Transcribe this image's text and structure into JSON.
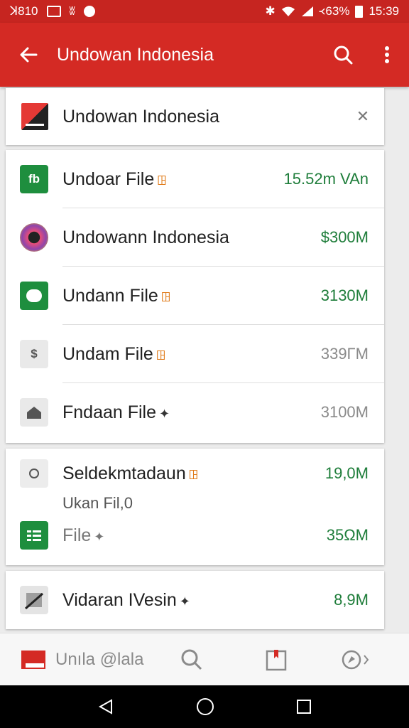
{
  "status_bar": {
    "left_text": "ꓘ810",
    "right_text": "᚜63%",
    "time": "15:39",
    "icons": [
      "image-icon",
      "bluetooth-icon",
      "dot-icon",
      "wifi-icon",
      "signal-icon",
      "battery-icon"
    ]
  },
  "appbar": {
    "title": "Undowan Indonesia",
    "icons": [
      "back-arrow-icon",
      "search-icon",
      "more-vert-icon"
    ]
  },
  "header_card": {
    "title": "Undowan Indonesia",
    "close_symbol": "✕"
  },
  "list": [
    {
      "name": "Undoar File",
      "tag": "ꖸ",
      "size": "15.52m VAn",
      "size_color": "green",
      "icon": "app-green-icon"
    },
    {
      "name": "Undowann Indonesia",
      "tag": "",
      "size": "$300M",
      "size_color": "green",
      "icon": "colorful-disc-icon"
    },
    {
      "name": "Undann File",
      "tag": "ꖸ",
      "size": "3130M",
      "size_color": "green",
      "icon": "chat-bubble-icon"
    },
    {
      "name": "Undam File",
      "tag": "ꖸ",
      "size": "339ΓM",
      "size_color": "grey",
      "icon": "dollar-doc-icon"
    },
    {
      "name": "Fndaan File",
      "tag": "✦",
      "size": "3100M",
      "size_color": "grey",
      "icon": "house-icon"
    }
  ],
  "section": {
    "title": "Seldekmtadaun",
    "tag": "ꖸ",
    "size": "19,0M",
    "subtitle": "Ukan Fil,0",
    "file_label": "File",
    "file_tag": "✦",
    "file_size": "35ΩM"
  },
  "last_item": {
    "name": "Vidaran IVesin",
    "tag": "✦",
    "size": "8,9M"
  },
  "bottom_nav": {
    "label": "Unıla @lala",
    "icons": [
      "inbox-icon",
      "search-icon",
      "bookmark-icon",
      "compass-icon"
    ]
  },
  "colors": {
    "primary": "#d42a24",
    "status": "#c62520",
    "accent_green": "#1e7d3a"
  }
}
